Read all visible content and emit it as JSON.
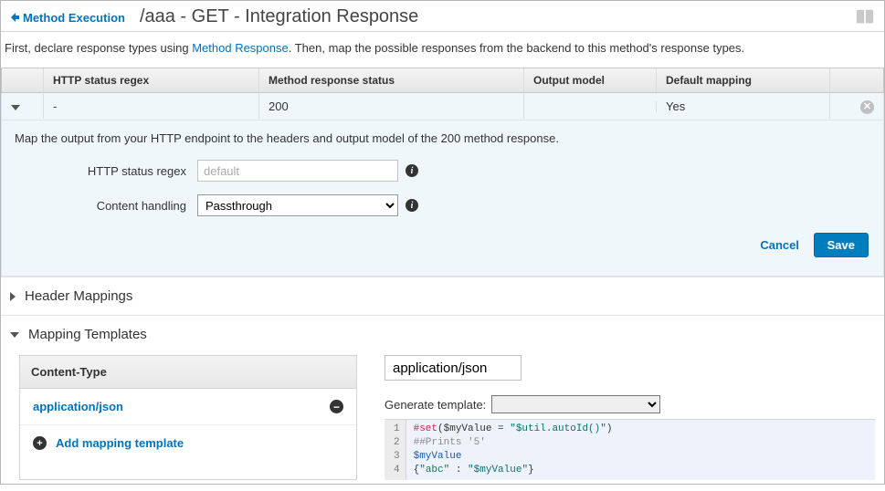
{
  "header": {
    "back_label": "Method Execution",
    "title": "/aaa - GET - Integration Response"
  },
  "intro": {
    "prefix": "First, declare response types using ",
    "link": "Method Response",
    "suffix": ". Then, map the possible responses from the backend to this method's response types."
  },
  "grid": {
    "headers": {
      "regex": "HTTP status regex",
      "status": "Method response status",
      "model": "Output model",
      "default": "Default mapping"
    },
    "row": {
      "regex": "-",
      "status": "200",
      "model": "",
      "default": "Yes"
    }
  },
  "detail": {
    "note": "Map the output from your HTTP endpoint to the headers and output model of the 200 method response.",
    "regex_label": "HTTP status regex",
    "regex_placeholder": "default",
    "content_label": "Content handling",
    "content_value": "Passthrough",
    "cancel": "Cancel",
    "save": "Save"
  },
  "sections": {
    "header_mappings": "Header Mappings",
    "mapping_templates": "Mapping Templates"
  },
  "mapping": {
    "ct_header": "Content-Type",
    "ct_value": "application/json",
    "add_label": "Add mapping template",
    "tpl_name": "application/json",
    "gen_label": "Generate template:",
    "code_lines": [
      [
        {
          "t": "#set",
          "c": "tok-red"
        },
        {
          "t": "($myValue = ",
          "c": ""
        },
        {
          "t": "\"$util.autoId()\"",
          "c": "tok-dteal"
        },
        {
          "t": ")",
          "c": ""
        }
      ],
      [
        {
          "t": "##Prints '5'",
          "c": "tok-grey"
        }
      ],
      [
        {
          "t": "$myValue",
          "c": "tok-navy"
        }
      ],
      [
        {
          "t": "{",
          "c": ""
        },
        {
          "t": "\"abc\"",
          "c": "tok-green"
        },
        {
          "t": " : ",
          "c": ""
        },
        {
          "t": "\"$myValue\"",
          "c": "tok-dteal"
        },
        {
          "t": "}",
          "c": ""
        }
      ]
    ]
  }
}
